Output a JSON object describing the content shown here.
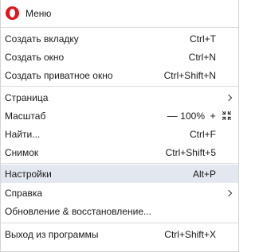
{
  "header": {
    "label": "Меню",
    "logo": "opera-logo"
  },
  "items": {
    "new_tab": {
      "label": "Создать вкладку",
      "shortcut": "Ctrl+T"
    },
    "new_window": {
      "label": "Создать окно",
      "shortcut": "Ctrl+N"
    },
    "private": {
      "label": "Создать приватное окно",
      "shortcut": "Ctrl+Shift+N"
    },
    "page": {
      "label": "Страница"
    },
    "zoom": {
      "label": "Масштаб",
      "minus": "—",
      "value": "100%",
      "plus": "+",
      "fullscreen_icon": "fullscreen-icon"
    },
    "find": {
      "label": "Найти...",
      "shortcut": "Ctrl+F"
    },
    "snapshot": {
      "label": "Снимок",
      "shortcut": "Ctrl+Shift+5"
    },
    "settings": {
      "label": "Настройки",
      "shortcut": "Alt+P"
    },
    "help": {
      "label": "Справка"
    },
    "update": {
      "label": "Обновление & восстановление..."
    },
    "exit": {
      "label": "Выход из программы",
      "shortcut": "Ctrl+Shift+X"
    }
  },
  "colors": {
    "accent_red": "#e0161c",
    "hover_bg": "#e3e7ef",
    "separator": "#dcdcdc"
  }
}
